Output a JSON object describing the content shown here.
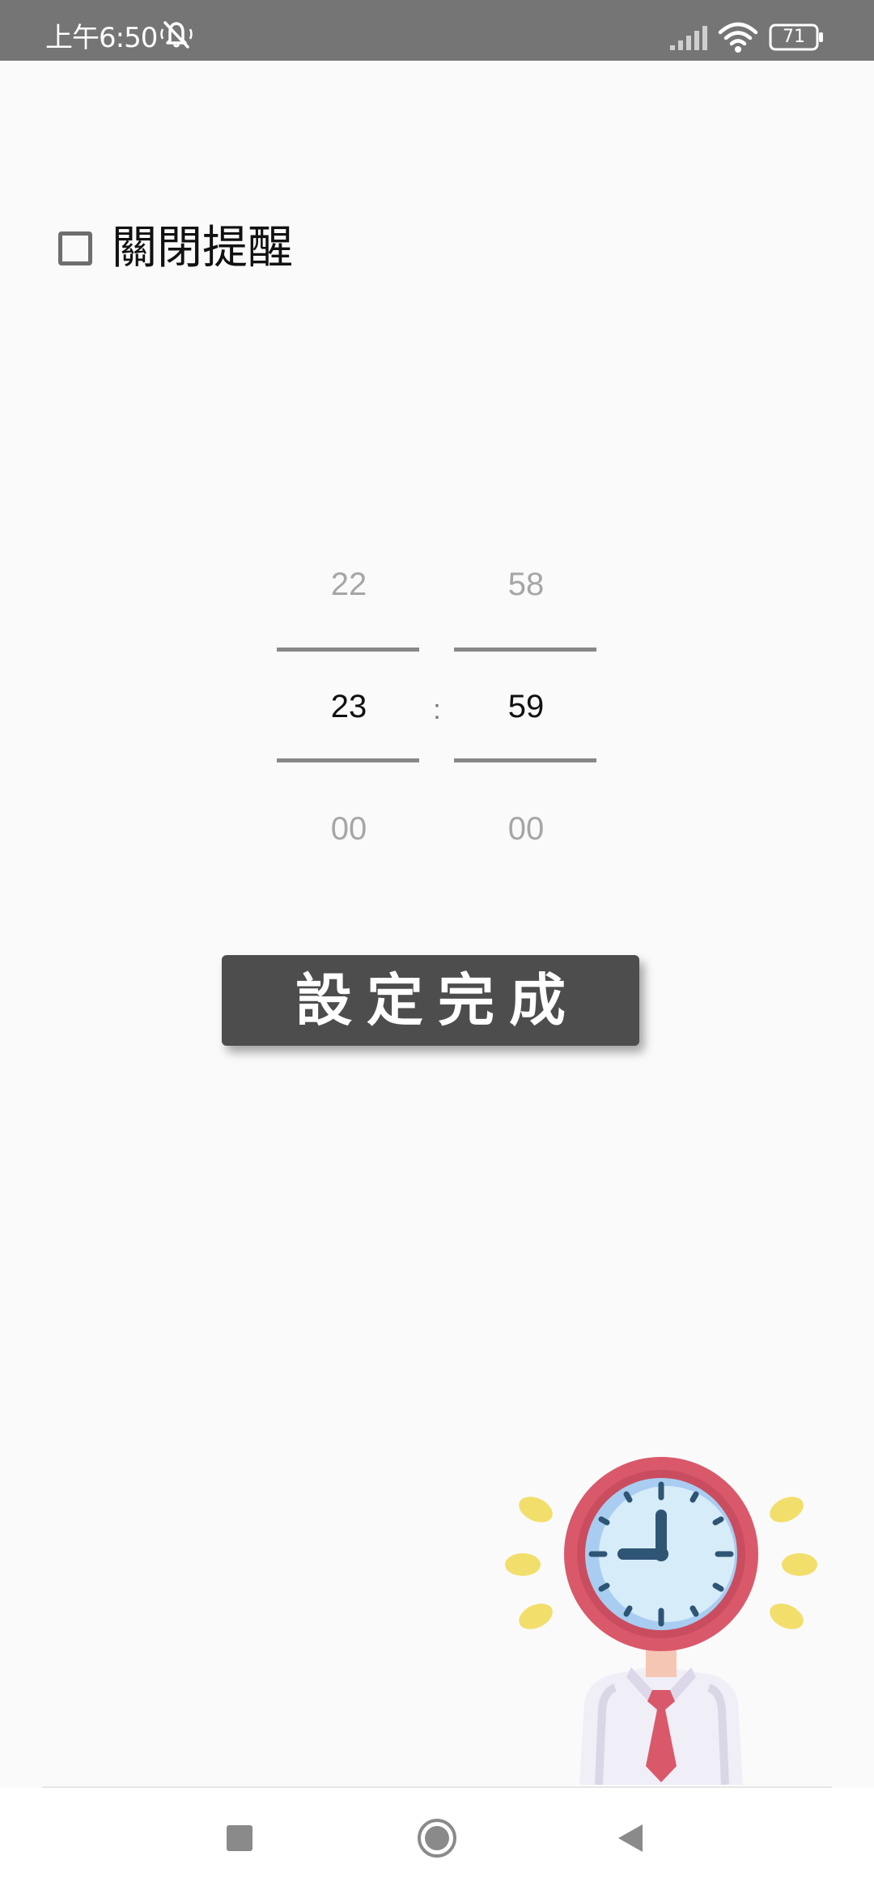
{
  "status_bar": {
    "time": "上午6:50",
    "icons": [
      "bell-muted-icon",
      "signal-icon",
      "wifi-icon",
      "battery-icon"
    ],
    "battery_level": "71"
  },
  "reminder": {
    "checkbox_label": "關閉提醒",
    "checked": false
  },
  "time_picker": {
    "hour_prev": "22",
    "hour_current": "23",
    "hour_next": "00",
    "minute_prev": "58",
    "minute_current": "59",
    "minute_next": "00",
    "separator": ":"
  },
  "done_button": {
    "label": "設定完成"
  },
  "illustration": {
    "icon": "clock-head-person-icon"
  },
  "nav_bar": {
    "items": [
      "recents-square-icon",
      "home-circle-icon",
      "back-triangle-icon"
    ]
  },
  "colors": {
    "status_bar_bg": "#757575",
    "page_bg": "#fafafa",
    "button_bg": "#4d4d4d",
    "clock_red": "#d9596b"
  }
}
